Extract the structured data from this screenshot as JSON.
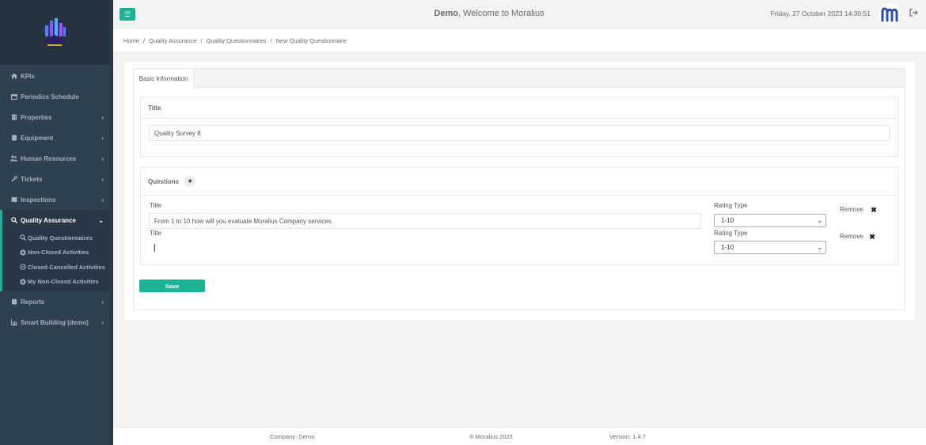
{
  "header": {
    "user": "Demo",
    "welcome_suffix": ", Welcome to Moralius",
    "datetime": "Friday, 27 October 2023 14:30:51"
  },
  "breadcrumb": [
    "Home",
    "Quality Assurance",
    "Quality Questionnaires",
    "New Quality Questionnaire"
  ],
  "sidebar": {
    "items": [
      {
        "label": "KPIs",
        "icon": "home-icon"
      },
      {
        "label": "Periodics Schedule",
        "icon": "calendar-icon"
      },
      {
        "label": "Properties",
        "icon": "building-icon"
      },
      {
        "label": "Equipment",
        "icon": "equipment-icon"
      },
      {
        "label": "Human Resources",
        "icon": "users-icon"
      },
      {
        "label": "Tickets",
        "icon": "wrench-icon"
      },
      {
        "label": "Inspections",
        "icon": "map-icon"
      },
      {
        "label": "Quality Assurance",
        "icon": "search-icon"
      },
      {
        "label": "Reports",
        "icon": "book-icon"
      },
      {
        "label": "Smart Building (demo)",
        "icon": "chart-icon"
      }
    ],
    "sub_items": [
      {
        "label": "Quality Questionnaires",
        "icon": "search-icon"
      },
      {
        "label": "Non-Closed Activities",
        "icon": "circle-plus-icon"
      },
      {
        "label": "Closed-Cancelled Activities",
        "icon": "circle-minus-icon"
      },
      {
        "label": "My Non-Closed Activities",
        "icon": "circle-plus-icon"
      }
    ]
  },
  "form": {
    "tab": "Basic Information",
    "title_section": "Title",
    "title_value": "Quality Survey 8",
    "questions_section": "Questions",
    "questions": [
      {
        "title_label": "Title",
        "title_value": "From 1 to 10 how will you evaluate Moralius Company services",
        "rating_label": "Rating Type",
        "rating_value": "1-10",
        "remove_label": "Remove"
      },
      {
        "title_label": "Title",
        "title_value": "",
        "rating_label": "Rating Type",
        "rating_value": "1-10",
        "remove_label": "Remove"
      }
    ],
    "save_label": "Save"
  },
  "footer": {
    "company": "Company: Demo",
    "copyright": "® Moralius 2023",
    "version": "Version: 1.4.7"
  },
  "colors": {
    "accent": "#1ab394",
    "sidebar": "#2f4050"
  }
}
